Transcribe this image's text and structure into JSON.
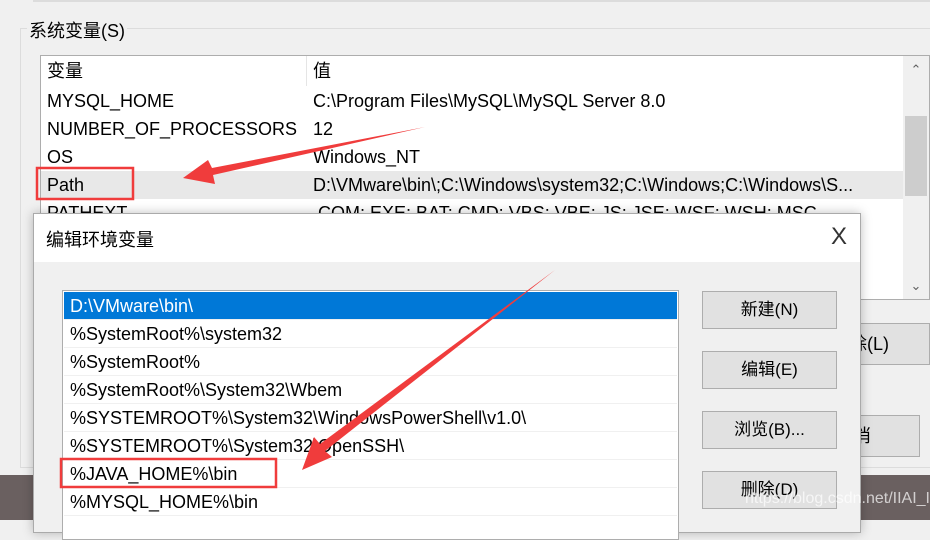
{
  "system_vars": {
    "group_label": "系统变量(S)",
    "columns": [
      "变量",
      "值"
    ],
    "rows": [
      {
        "name": "MYSQL_HOME",
        "value": "C:\\Program Files\\MySQL\\MySQL Server 8.0"
      },
      {
        "name": "NUMBER_OF_PROCESSORS",
        "value": "12"
      },
      {
        "name": "OS",
        "value": "Windows_NT"
      },
      {
        "name": "Path",
        "value": "D:\\VMware\\bin\\;C:\\Windows\\system32;C:\\Windows;C:\\Windows\\S..."
      },
      {
        "name": "PATHEXT",
        "value": ".COM;.EXE;.BAT;.CMD;.VBS;.VBE;.JS;.JSE;.WSF;.WSH;.MSC"
      }
    ],
    "selected_row": "Path",
    "delete_button_partial": "除(L)",
    "cancel_button_partial": "消"
  },
  "dialog": {
    "title": "编辑环境变量",
    "close_glyph": "X",
    "items": [
      "D:\\VMware\\bin\\",
      "%SystemRoot%\\system32",
      "%SystemRoot%",
      "%SystemRoot%\\System32\\Wbem",
      "%SYSTEMROOT%\\System32\\WindowsPowerShell\\v1.0\\",
      "%SYSTEMROOT%\\System32\\OpenSSH\\",
      "%JAVA_HOME%\\bin",
      "%MYSQL_HOME%\\bin"
    ],
    "selected_item": "D:\\VMware\\bin\\",
    "buttons": {
      "new": "新建(N)",
      "edit": "编辑(E)",
      "browse": "浏览(B)...",
      "delete": "删除(D)"
    }
  },
  "watermark": "https://blog.csdn.net/IIAI_IAII",
  "colors": {
    "selection": "#0078d7",
    "annotation": "#f03c3c"
  }
}
